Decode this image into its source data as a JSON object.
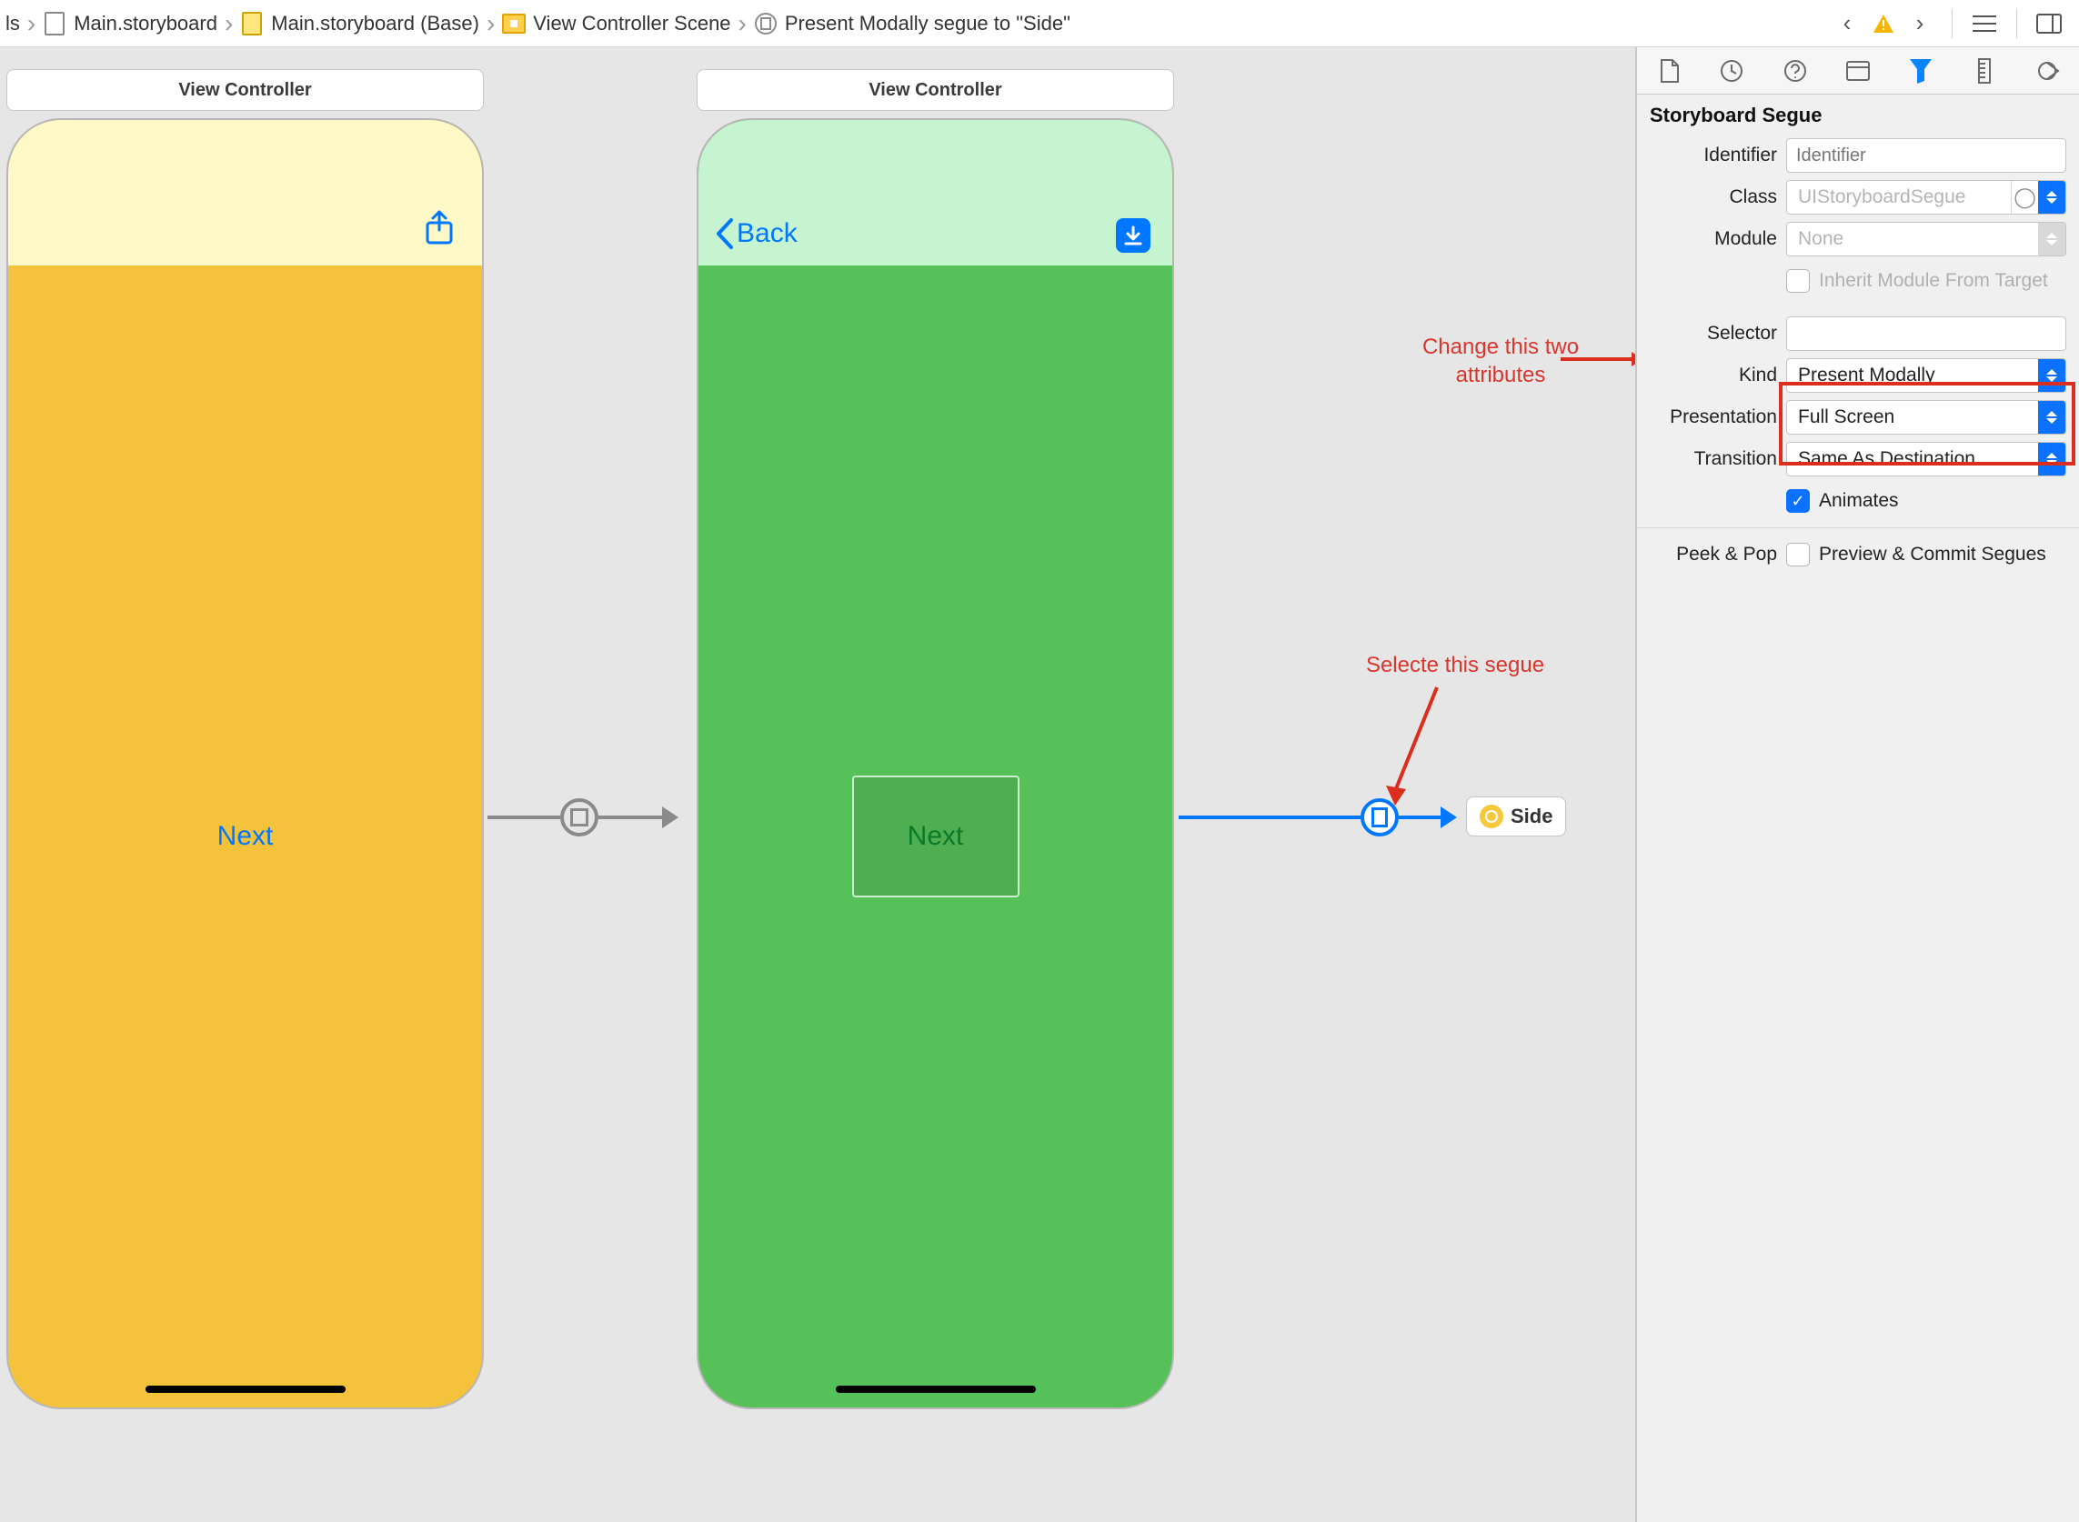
{
  "breadcrumbs": {
    "b0": "ls",
    "b1": "Main.storyboard",
    "b2": "Main.storyboard (Base)",
    "b3": "View Controller Scene",
    "b4": "Present Modally segue to \"Side\""
  },
  "canvas": {
    "vc1_title": "View Controller",
    "vc1_next": "Next",
    "vc2_title": "View Controller",
    "vc2_back": "Back",
    "vc2_next": "Next",
    "side_label": "Side"
  },
  "annotations": {
    "anno1_l1": "Change this two",
    "anno1_l2": "attributes",
    "anno2": "Selecte this segue"
  },
  "inspector": {
    "section": "Storyboard Segue",
    "identifier_label": "Identifier",
    "identifier_placeholder": "Identifier",
    "class_label": "Class",
    "class_value": "UIStoryboardSegue",
    "module_label": "Module",
    "module_value": "None",
    "inherit_label": "Inherit Module From Target",
    "selector_label": "Selector",
    "kind_label": "Kind",
    "kind_value": "Present Modally",
    "presentation_label": "Presentation",
    "presentation_value": "Full Screen",
    "transition_label": "Transition",
    "transition_value": "Same As Destination",
    "animates_label": "Animates",
    "peek_label": "Peek & Pop",
    "peek_opt": "Preview & Commit Segues"
  }
}
